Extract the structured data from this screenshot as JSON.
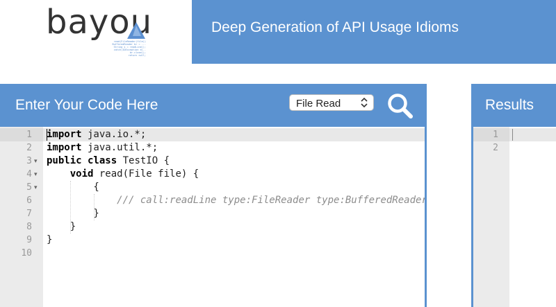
{
  "logo": {
    "text": "bayou",
    "code_snippet": "  read(FileReader(file))\n  BufferedReader br = ...\n  String s = readLine();\n  catch(IOException e)..\n  br.close();\n  return null;"
  },
  "header": {
    "title": "Deep Generation of API Usage Idioms"
  },
  "editor": {
    "title": "Enter Your Code Here",
    "selected_example": "File Read",
    "lines": [
      {
        "n": "1",
        "fold": ""
      },
      {
        "n": "2",
        "fold": ""
      },
      {
        "n": "3",
        "fold": "▾"
      },
      {
        "n": "4",
        "fold": "▾"
      },
      {
        "n": "5",
        "fold": "▾"
      },
      {
        "n": "6",
        "fold": ""
      },
      {
        "n": "7",
        "fold": ""
      },
      {
        "n": "8",
        "fold": ""
      },
      {
        "n": "9",
        "fold": ""
      },
      {
        "n": "10",
        "fold": ""
      }
    ],
    "code": {
      "l1_kw": "import",
      "l1_rest": " java.io.*;",
      "l2_kw": "import",
      "l2_rest": " java.util.*;",
      "l3_kw": "public class",
      "l3_rest": " TestIO {",
      "l4_indent": "    ",
      "l4_kw": "void",
      "l4_rest": " read(File file) {",
      "l5": "        {",
      "l6_indent": "            ",
      "l6_comment": "/// call:readLine type:FileReader type:BufferedReader",
      "l7": "        }",
      "l8": "    }",
      "l9": "}",
      "l10": ""
    }
  },
  "results": {
    "title": "Results",
    "lines": [
      "1",
      "2"
    ]
  },
  "colors": {
    "brand_blue": "#5b92d0",
    "gutter": "#ebebeb"
  },
  "icons": {
    "search": "magnifier-icon",
    "select": "select-arrows-icon"
  }
}
